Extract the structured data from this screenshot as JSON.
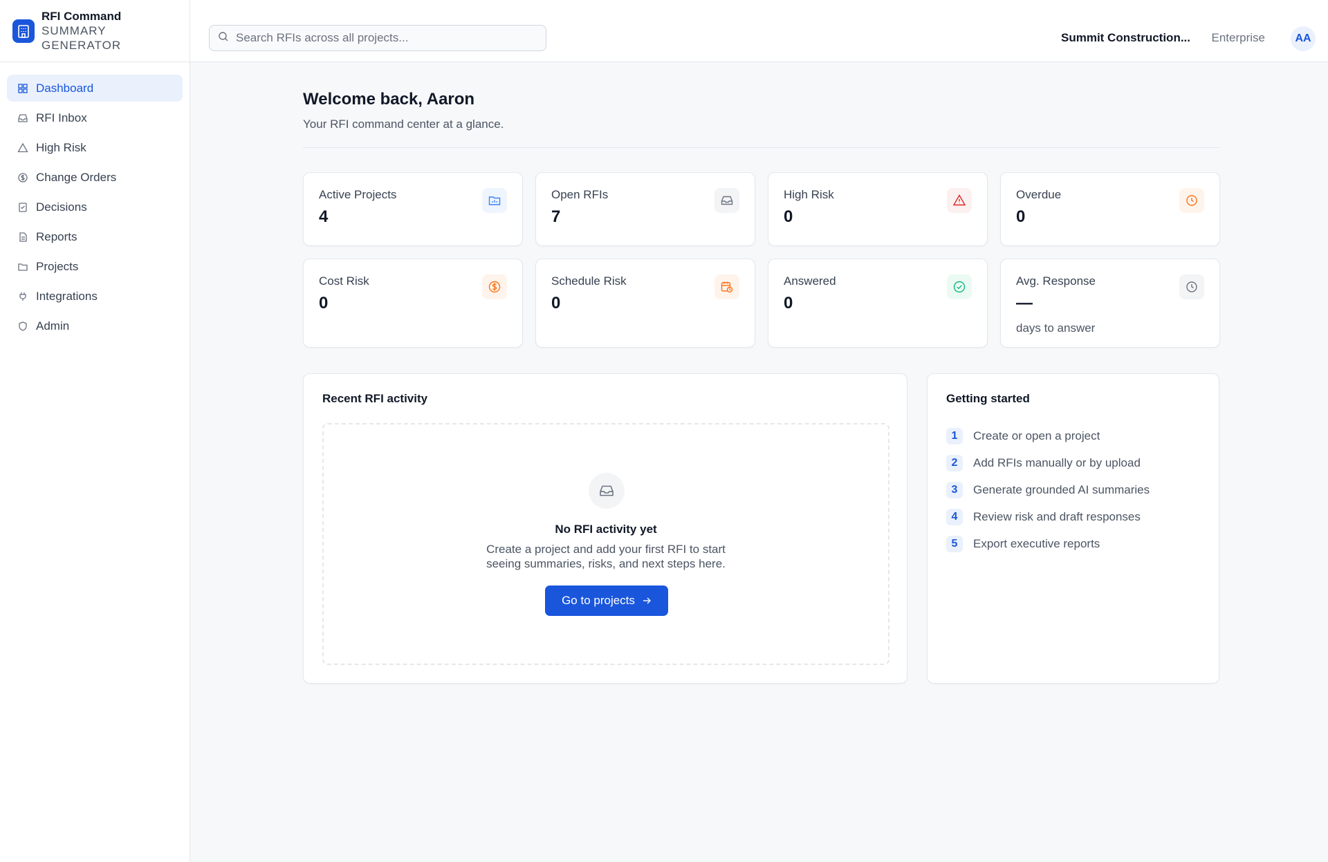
{
  "app": {
    "name": "RFI Command",
    "subtitle_line1": "SUMMARY",
    "subtitle_line2": "GENERATOR"
  },
  "sidebar": {
    "items": [
      {
        "label": "Dashboard",
        "icon": "grid-icon",
        "active": true
      },
      {
        "label": "RFI Inbox",
        "icon": "inbox-icon"
      },
      {
        "label": "High Risk",
        "icon": "warning-triangle-icon"
      },
      {
        "label": "Change Orders",
        "icon": "dollar-circle-icon"
      },
      {
        "label": "Decisions",
        "icon": "checklist-icon"
      },
      {
        "label": "Reports",
        "icon": "document-icon"
      },
      {
        "label": "Projects",
        "icon": "folder-icon"
      },
      {
        "label": "Integrations",
        "icon": "plug-icon"
      },
      {
        "label": "Admin",
        "icon": "shield-icon"
      }
    ]
  },
  "header": {
    "search_placeholder": "Search RFIs across all projects...",
    "org_name": "Summit Construction...",
    "plan": "Enterprise",
    "avatar_initials": "AA"
  },
  "main": {
    "title": "Welcome back, Aaron",
    "subtitle": "Your RFI command center at a glance."
  },
  "stats": [
    {
      "label": "Active Projects",
      "value": "4",
      "icon": "folder-chart-icon",
      "color": "#3b82f6"
    },
    {
      "label": "Open RFIs",
      "value": "7",
      "icon": "inbox-icon",
      "color": "#6b7280"
    },
    {
      "label": "High Risk",
      "value": "0",
      "icon": "warning-triangle-icon",
      "color": "#dc2626"
    },
    {
      "label": "Overdue",
      "value": "0",
      "icon": "clock-icon",
      "color": "#f97316"
    },
    {
      "label": "Cost Risk",
      "value": "0",
      "icon": "dollar-circle-icon",
      "color": "#f97316"
    },
    {
      "label": "Schedule Risk",
      "value": "0",
      "icon": "calendar-clock-icon",
      "color": "#f97316"
    },
    {
      "label": "Answered",
      "value": "0",
      "icon": "check-circle-icon",
      "color": "#10b981"
    },
    {
      "label": "Avg. Response",
      "value": "—",
      "note": "days to answer",
      "icon": "clock-icon",
      "color": "#6b7280"
    }
  ],
  "activity": {
    "title": "Recent RFI activity",
    "empty_title": "No RFI activity yet",
    "empty_desc_line1": "Create a project and add your first RFI to start",
    "empty_desc_line2": "seeing summaries, risks, and next steps here.",
    "cta_label": "Go to projects"
  },
  "getting_started": {
    "title": "Getting started",
    "steps": [
      {
        "num": "1",
        "text": "Create or open a project"
      },
      {
        "num": "2",
        "text": "Add RFIs manually or by upload"
      },
      {
        "num": "3",
        "text": "Generate grounded AI summaries"
      },
      {
        "num": "4",
        "text": "Review risk and draft responses"
      },
      {
        "num": "5",
        "text": "Export executive reports"
      }
    ]
  }
}
